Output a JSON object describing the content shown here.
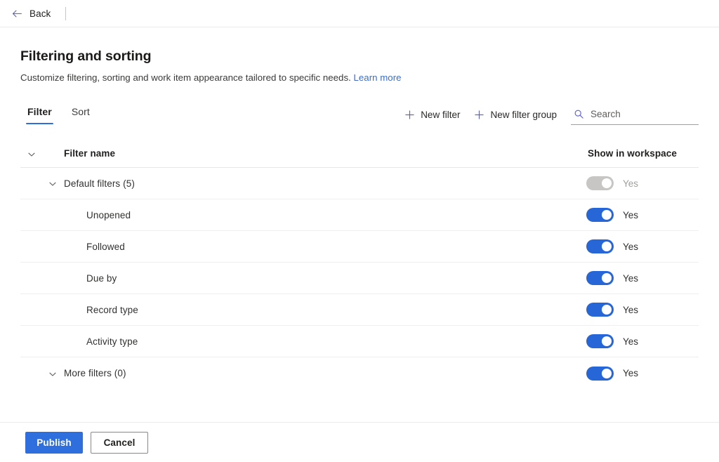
{
  "topbar": {
    "back_label": "Back",
    "back_icon": "arrow-left-icon"
  },
  "header": {
    "title": "Filtering and sorting",
    "subtitle": "Customize filtering, sorting and work item appearance tailored to specific needs.",
    "learn_more_label": "Learn more"
  },
  "tabs": [
    {
      "label": "Filter",
      "active": true
    },
    {
      "label": "Sort",
      "active": false
    }
  ],
  "commands": {
    "new_filter_label": "New filter",
    "new_filter_group_label": "New filter group",
    "plus_icon": "plus-icon"
  },
  "search": {
    "placeholder": "Search",
    "value": "",
    "icon": "search-icon"
  },
  "table": {
    "columns": {
      "name": "Filter name",
      "show_in_workspace": "Show in workspace"
    },
    "rows": [
      {
        "label": "Default filters (5)",
        "indent": 1,
        "has_chevron": true,
        "toggle_on": true,
        "toggle_disabled": true,
        "toggle_label": "Yes"
      },
      {
        "label": "Unopened",
        "indent": 2,
        "has_chevron": false,
        "toggle_on": true,
        "toggle_disabled": false,
        "toggle_label": "Yes"
      },
      {
        "label": "Followed",
        "indent": 2,
        "has_chevron": false,
        "toggle_on": true,
        "toggle_disabled": false,
        "toggle_label": "Yes"
      },
      {
        "label": "Due by",
        "indent": 2,
        "has_chevron": false,
        "toggle_on": true,
        "toggle_disabled": false,
        "toggle_label": "Yes"
      },
      {
        "label": "Record type",
        "indent": 2,
        "has_chevron": false,
        "toggle_on": true,
        "toggle_disabled": false,
        "toggle_label": "Yes"
      },
      {
        "label": "Activity type",
        "indent": 2,
        "has_chevron": false,
        "toggle_on": true,
        "toggle_disabled": false,
        "toggle_label": "Yes"
      },
      {
        "label": "More filters (0)",
        "indent": 1,
        "has_chevron": true,
        "toggle_on": true,
        "toggle_disabled": false,
        "toggle_label": "Yes"
      }
    ]
  },
  "footer": {
    "publish_label": "Publish",
    "cancel_label": "Cancel"
  },
  "colors": {
    "accent_blue": "#2f6fdd",
    "toggle_on": "#2766d6",
    "toggle_disabled": "#c8c6c4",
    "icon_purple": "#5b5fc7",
    "link": "#3b6ccc"
  }
}
